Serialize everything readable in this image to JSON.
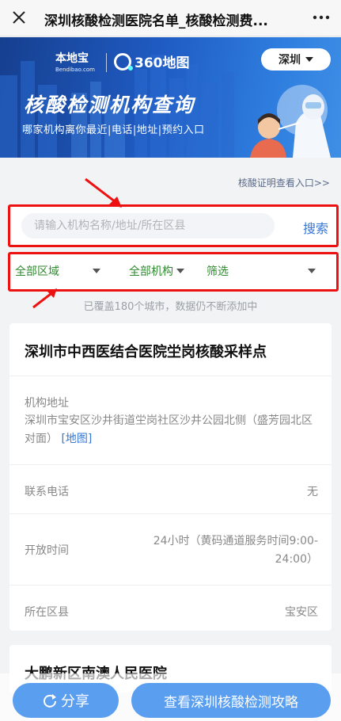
{
  "topbar": {
    "title": "深圳核酸检测医院名单_核酸检测费...",
    "close_icon": "close-icon",
    "more_icon": "more-icon"
  },
  "banner": {
    "brand_bendibao": "本地宝",
    "brand_bendibao_sub": "Bendibao.com",
    "brand_360": "360地图",
    "city": "深圳",
    "title": "核酸检测机构查询",
    "subtitle": "哪家机构离你最近|电话|地址|预约入口"
  },
  "proof_link": "核酸证明查看入口>>",
  "search": {
    "placeholder": "请输入机构名称/地址/所在区县",
    "button": "搜索"
  },
  "filters": {
    "area": "全部区域",
    "org": "全部机构",
    "screen": "筛选"
  },
  "coverage": "已覆盖180个城市，数据仍不断添加中",
  "card": {
    "title": "深圳市中西医结合医院坣岗核酸采样点",
    "addr_label": "机构地址",
    "addr_value": "深圳市宝安区沙井街道坣岗社区沙井公园北侧（盛芳园北区对面）",
    "map_link": "[地图]",
    "phone_label": "联系电话",
    "phone_value": "无",
    "hours_label": "开放时间",
    "hours_value": "24小时（黄码通道服务时间9:00-24:00）",
    "district_label": "所在区县",
    "district_value": "宝安区"
  },
  "card2": {
    "title": "大鹏新区南澳人民医院"
  },
  "bottom": {
    "share": "分享",
    "guide": "查看深圳核酸检测攻略"
  },
  "colors": {
    "banner": "#1f5bc2",
    "button": "#5a9ef0",
    "filter_text": "#2f8a2f",
    "highlight": "#ee1111",
    "link": "#3677d6"
  }
}
